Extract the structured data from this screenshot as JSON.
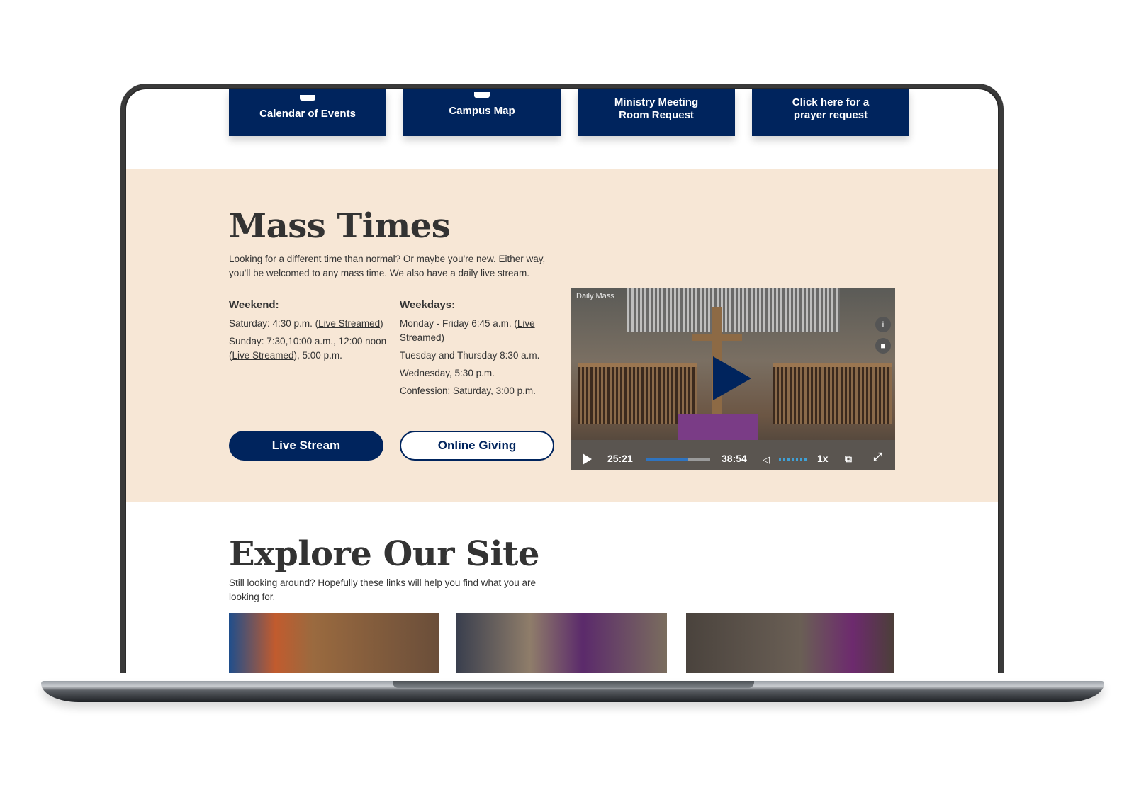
{
  "tiles": [
    {
      "label": "Calendar of Events",
      "icon": "calendar-icon"
    },
    {
      "label": "Campus Map",
      "icon": "map-icon"
    },
    {
      "label": "Ministry Meeting Room Request",
      "line1": "Ministry Meeting",
      "line2": "Room Request",
      "icon": "room-icon"
    },
    {
      "label": "Click here for a prayer request",
      "line1": "Click here for a",
      "line2": "prayer request",
      "icon": "prayer-icon"
    }
  ],
  "mass": {
    "title": "Mass Times",
    "intro": "Looking for a different time than normal? Or maybe you're new. Either way, you'll be welcomed to any mass time. We also have a daily live stream.",
    "weekend": {
      "heading": "Weekend:",
      "sat_prefix": "Saturday: 4:30 p.m. (",
      "sat_link": "Live Streamed",
      "sat_suffix": ")",
      "sun_prefix": "Sunday: 7:30,10:00 a.m., 12:00 noon (",
      "sun_link": "Live Streamed",
      "sun_suffix": "), 5:00 p.m."
    },
    "weekdays": {
      "heading": "Weekdays:",
      "mf_prefix": "Monday - Friday 6:45 a.m. (",
      "mf_link": "Live Streamed",
      "mf_suffix": ")",
      "tue_thu": "Tuesday and Thursday 8:30 a.m.",
      "wed": "Wednesday, 5:30 p.m.",
      "confession": "Confession: Saturday, 3:00 p.m."
    },
    "buttons": {
      "live_stream": "Live Stream",
      "online_giving": "Online Giving"
    }
  },
  "video": {
    "label": "Daily Mass",
    "current_time": "25:21",
    "duration": "38:54",
    "progress": 0.65,
    "speed": "1x",
    "info_glyph": "i"
  },
  "explore": {
    "title": "Explore Our Site",
    "intro": "Still looking around? Hopefully these links will help you find what you are looking for."
  },
  "colors": {
    "navy": "#00245d",
    "beige": "#f7e7d6",
    "text": "#333333"
  }
}
